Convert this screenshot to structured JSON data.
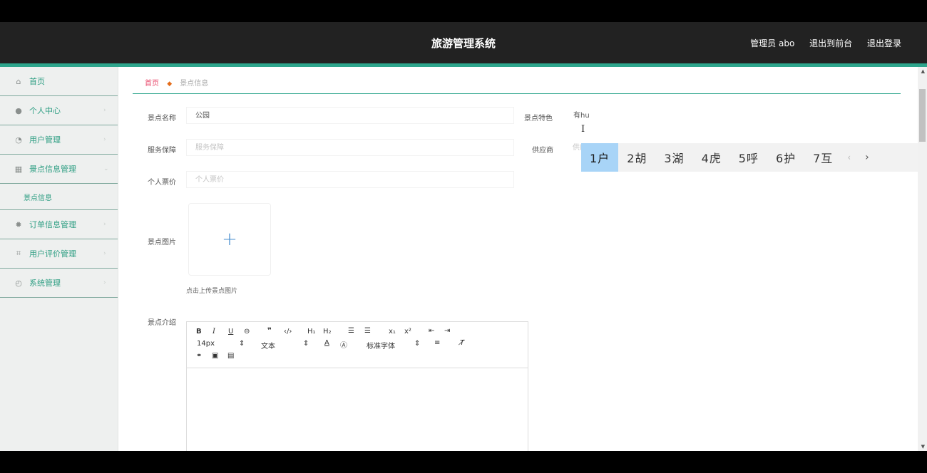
{
  "header": {
    "title": "旅游管理系统",
    "admin": "管理员 abo",
    "to_front": "退出到前台",
    "logout": "退出登录"
  },
  "sidebar": {
    "items": [
      {
        "label": "首页",
        "icon": "home-icon"
      },
      {
        "label": "个人中心",
        "icon": "user-icon"
      },
      {
        "label": "用户管理",
        "icon": "users-icon"
      },
      {
        "label": "景点信息管理",
        "icon": "grid-icon"
      },
      {
        "label": "订单信息管理",
        "icon": "gear-icon"
      },
      {
        "label": "用户评价管理",
        "icon": "comment-icon"
      },
      {
        "label": "系统管理",
        "icon": "settings-icon"
      }
    ],
    "sub_item": "景点信息"
  },
  "breadcrumb": {
    "home": "首页",
    "current": "景点信息"
  },
  "form": {
    "name_label": "景点名称",
    "name_value": "公园",
    "feature_label": "景点特色",
    "feature_value": "有hu",
    "service_label": "服务保障",
    "service_placeholder": "服务保障",
    "supplier_label": "供应商",
    "supplier_placeholder": "供应商",
    "price_label": "个人票价",
    "price_placeholder": "个人票价",
    "image_label": "景点图片",
    "upload_hint": "点击上传景点图片",
    "intro_label": "景点介绍"
  },
  "editor": {
    "font_size": "14px",
    "block_type": "文本",
    "font_family": "标准字体"
  },
  "ime": {
    "candidates": [
      "1户",
      "2胡",
      "3湖",
      "4虎",
      "5呼",
      "6护",
      "7互"
    ]
  }
}
